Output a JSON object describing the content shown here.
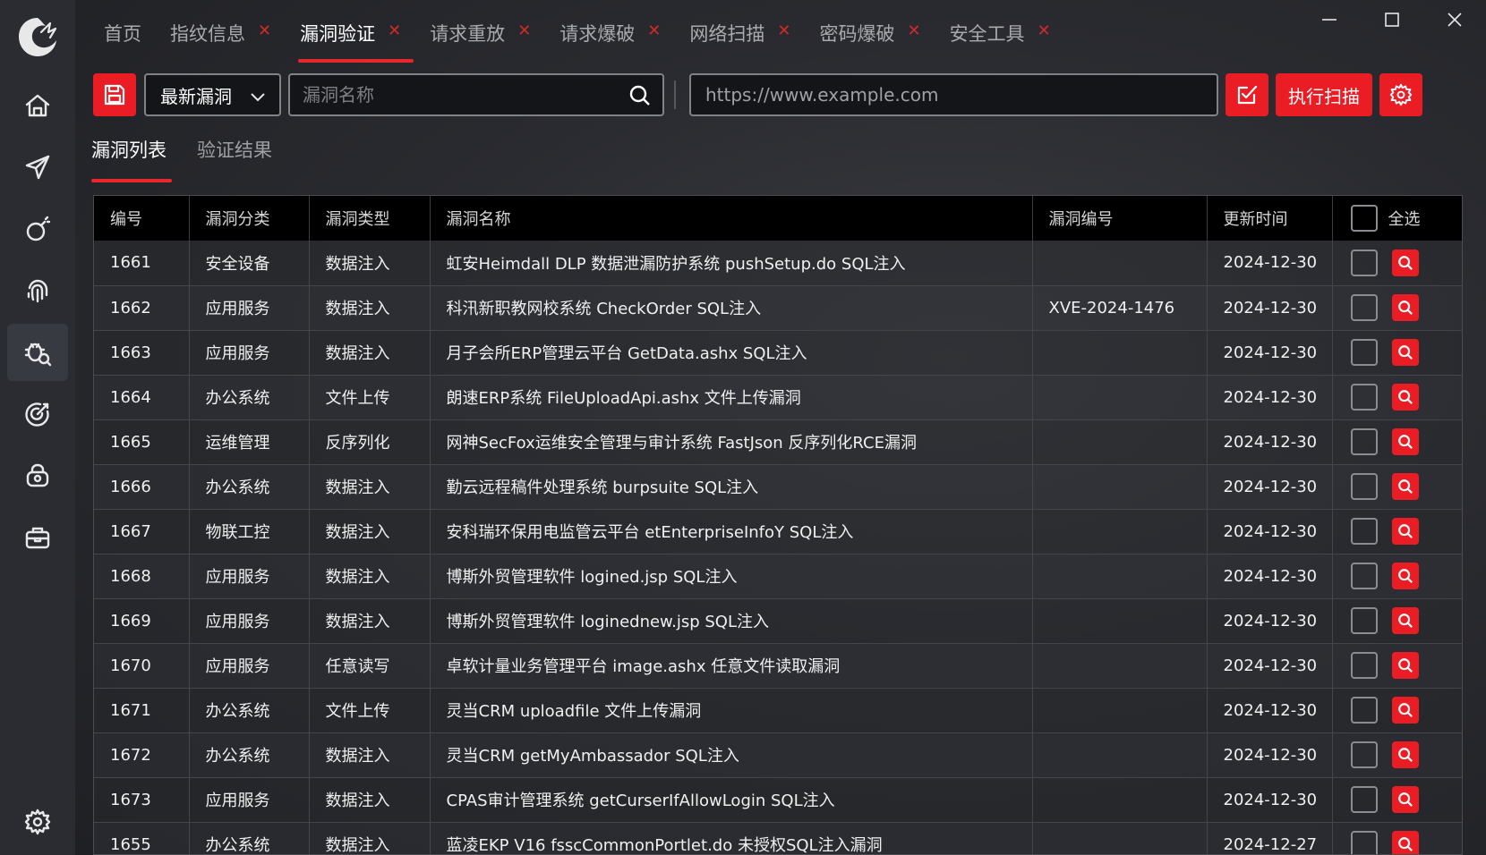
{
  "window": {
    "tabs": [
      {
        "label": "首页",
        "closable": false
      },
      {
        "label": "指纹信息",
        "closable": true
      },
      {
        "label": "漏洞验证",
        "closable": true,
        "active": true
      },
      {
        "label": "请求重放",
        "closable": true
      },
      {
        "label": "请求爆破",
        "closable": true
      },
      {
        "label": "网络扫描",
        "closable": true
      },
      {
        "label": "密码爆破",
        "closable": true
      },
      {
        "label": "安全工具",
        "closable": true
      }
    ],
    "close_glyph": "✕"
  },
  "sidebar": {
    "items": [
      {
        "name": "home-icon"
      },
      {
        "name": "paper-plane-icon"
      },
      {
        "name": "bomb-icon"
      },
      {
        "name": "fingerprint-icon"
      },
      {
        "name": "bug-search-icon",
        "active": true
      },
      {
        "name": "target-icon"
      },
      {
        "name": "lock-icon"
      },
      {
        "name": "toolbox-icon"
      }
    ],
    "bottom": "gear-icon"
  },
  "toolbar": {
    "category_selected": "最新漏洞",
    "search_placeholder": "漏洞名称",
    "url_placeholder": "https://www.example.com",
    "scan_label": "执行扫描",
    "accent": "#ea1d25"
  },
  "subtabs": [
    {
      "label": "漏洞列表",
      "active": true
    },
    {
      "label": "验证结果"
    }
  ],
  "table": {
    "headers": [
      "编号",
      "漏洞分类",
      "漏洞类型",
      "漏洞名称",
      "漏洞编号",
      "更新时间"
    ],
    "select_all_label": "全选",
    "rows": [
      [
        "1661",
        "安全设备",
        "数据注入",
        "虹安Heimdall DLP 数据泄漏防护系统 pushSetup.do SQL注入",
        "",
        "2024-12-30"
      ],
      [
        "1662",
        "应用服务",
        "数据注入",
        "科汛新职教网校系统 CheckOrder SQL注入",
        "XVE-2024-1476",
        "2024-12-30"
      ],
      [
        "1663",
        "应用服务",
        "数据注入",
        "月子会所ERP管理云平台 GetData.ashx SQL注入",
        "",
        "2024-12-30"
      ],
      [
        "1664",
        "办公系统",
        "文件上传",
        "朗速ERP系统 FileUploadApi.ashx 文件上传漏洞",
        "",
        "2024-12-30"
      ],
      [
        "1665",
        "运维管理",
        "反序列化",
        "网神SecFox运维安全管理与审计系统 FastJson 反序列化RCE漏洞",
        "",
        "2024-12-30"
      ],
      [
        "1666",
        "办公系统",
        "数据注入",
        "勤云远程稿件处理系统 burpsuite SQL注入",
        "",
        "2024-12-30"
      ],
      [
        "1667",
        "物联工控",
        "数据注入",
        "安科瑞环保用电监管云平台 etEnterpriseInfoY SQL注入",
        "",
        "2024-12-30"
      ],
      [
        "1668",
        "应用服务",
        "数据注入",
        "博斯外贸管理软件 logined.jsp SQL注入",
        "",
        "2024-12-30"
      ],
      [
        "1669",
        "应用服务",
        "数据注入",
        "博斯外贸管理软件 loginednew.jsp SQL注入",
        "",
        "2024-12-30"
      ],
      [
        "1670",
        "应用服务",
        "任意读写",
        "卓软计量业务管理平台 image.ashx 任意文件读取漏洞",
        "",
        "2024-12-30"
      ],
      [
        "1671",
        "办公系统",
        "文件上传",
        "灵当CRM uploadfile 文件上传漏洞",
        "",
        "2024-12-30"
      ],
      [
        "1672",
        "办公系统",
        "数据注入",
        "灵当CRM getMyAmbassador SQL注入",
        "",
        "2024-12-30"
      ],
      [
        "1673",
        "应用服务",
        "数据注入",
        "CPAS审计管理系统 getCurserIfAllowLogin SQL注入",
        "",
        "2024-12-30"
      ],
      [
        "1655",
        "办公系统",
        "数据注入",
        "蓝凌EKP V16 fsscCommonPortlet.do 未授权SQL注入漏洞",
        "",
        "2024-12-27"
      ]
    ]
  }
}
